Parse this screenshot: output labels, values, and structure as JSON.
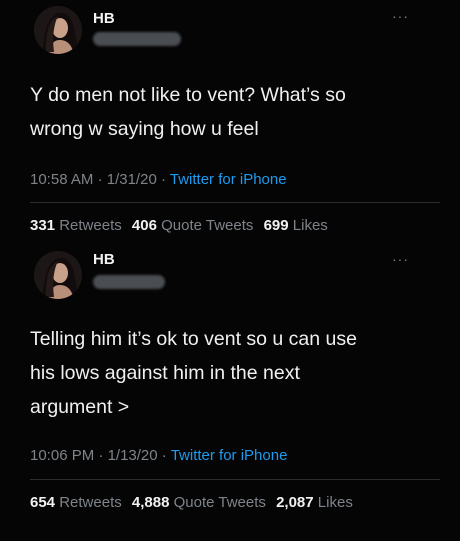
{
  "tweets": [
    {
      "author": "HB",
      "more_icon": "more-dots-icon",
      "lines": [
        "Y do men not like to vent? What’s so",
        "wrong w saying how u feel"
      ],
      "time": "10:58 AM",
      "date": "1/31/20",
      "source": "Twitter for iPhone",
      "retweets_count": "331",
      "retweets_label": "Retweets",
      "quotes_count": "406",
      "quotes_label": "Quote Tweets",
      "likes_count": "699",
      "likes_label": "Likes"
    },
    {
      "author": "HB",
      "more_icon": "more-dots-icon",
      "lines": [
        "Telling him it’s ok to vent so u can use",
        "his lows against him in the next",
        "argument >"
      ],
      "time": "10:06 PM",
      "date": "1/13/20",
      "source": "Twitter for iPhone",
      "retweets_count": "654",
      "retweets_label": "Retweets",
      "quotes_count": "4,888",
      "quotes_label": "Quote Tweets",
      "likes_count": "2,087",
      "likes_label": "Likes"
    }
  ],
  "colors": {
    "background": "#050505",
    "text": "#f0f0f0",
    "secondary": "#7e848a",
    "link": "#1d9bf0"
  }
}
